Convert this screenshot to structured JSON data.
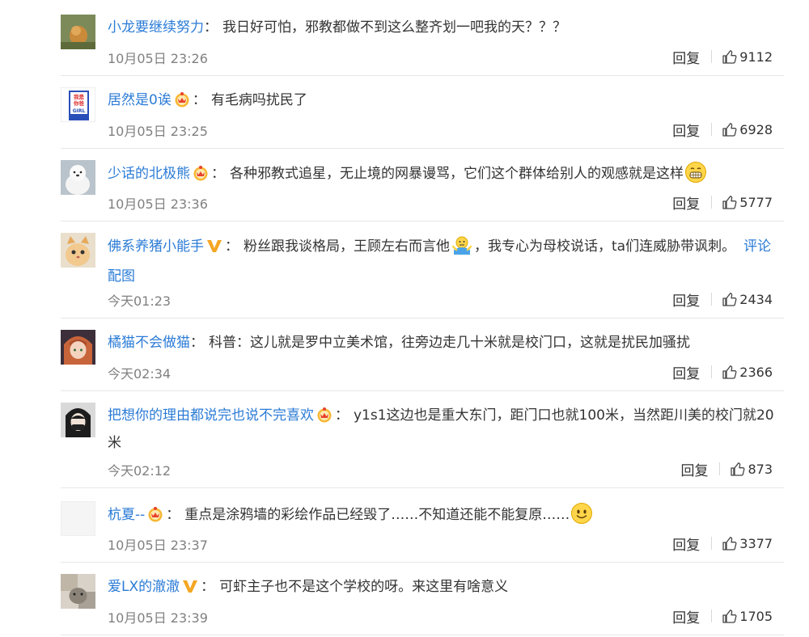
{
  "comments": [
    {
      "user": "小龙要继续努力",
      "colon": "：",
      "segments": [
        "我日好可怕，邪教都做不到这么整齐划一吧我的天？？？"
      ],
      "time": "10月05日 23:26",
      "reply": "回复",
      "likes": "9112"
    },
    {
      "user": "居然是0诶",
      "colon": "：",
      "segments": [
        "有毛病吗扰民了"
      ],
      "time": "10月05日 23:25",
      "reply": "回复",
      "likes": "6928",
      "avatar_text": [
        "我是",
        "你爸",
        "GIRL"
      ]
    },
    {
      "user": "少话的北极熊",
      "colon": "：",
      "segments": [
        "各种邪教式追星，无止境的网暴谩骂，它们这个群体给别人的观感就是这样"
      ],
      "time": "10月05日 23:36",
      "reply": "回复",
      "likes": "5777"
    },
    {
      "user": "佛系养猪小能手",
      "colon": "：",
      "segments": [
        "粉丝跟我谈格局，王顾左右而言他",
        "，我专心为母校说话，ta们连威胁带讽刺。"
      ],
      "link": "评论配图",
      "time": "今天01:23",
      "reply": "回复",
      "likes": "2434"
    },
    {
      "user": "橘猫不会做猫",
      "colon": "：",
      "segments": [
        "科普：这儿就是罗中立美术馆，往旁边走几十米就是校门口，这就是扰民加骚扰"
      ],
      "time": "今天02:34",
      "reply": "回复",
      "likes": "2366"
    },
    {
      "user": "把想你的理由都说完也说不完喜欢",
      "colon": "：",
      "segments": [
        "y1s1这边也是重大东门，距门口也就100米，当然距川美的校门就20米"
      ],
      "time": "今天02:12",
      "reply": "回复",
      "likes": "873"
    },
    {
      "user": "杭夏--",
      "colon": "：",
      "segments": [
        "重点是涂鸦墙的彩绘作品已经毁了……不知道还能不能复原……"
      ],
      "time": "10月05日 23:37",
      "reply": "回复",
      "likes": "3377"
    },
    {
      "user": "爱LX的澈澈",
      "colon": "：",
      "segments": [
        "可虾主子也不是这个学校的呀。来这里有啥意义"
      ],
      "time": "10月05日 23:39",
      "reply": "回复",
      "likes": "1705"
    }
  ],
  "colors": {
    "link": "#2b7bd6",
    "time": "#808080",
    "divider": "#e6e6e6",
    "badge": "#f5a623"
  }
}
